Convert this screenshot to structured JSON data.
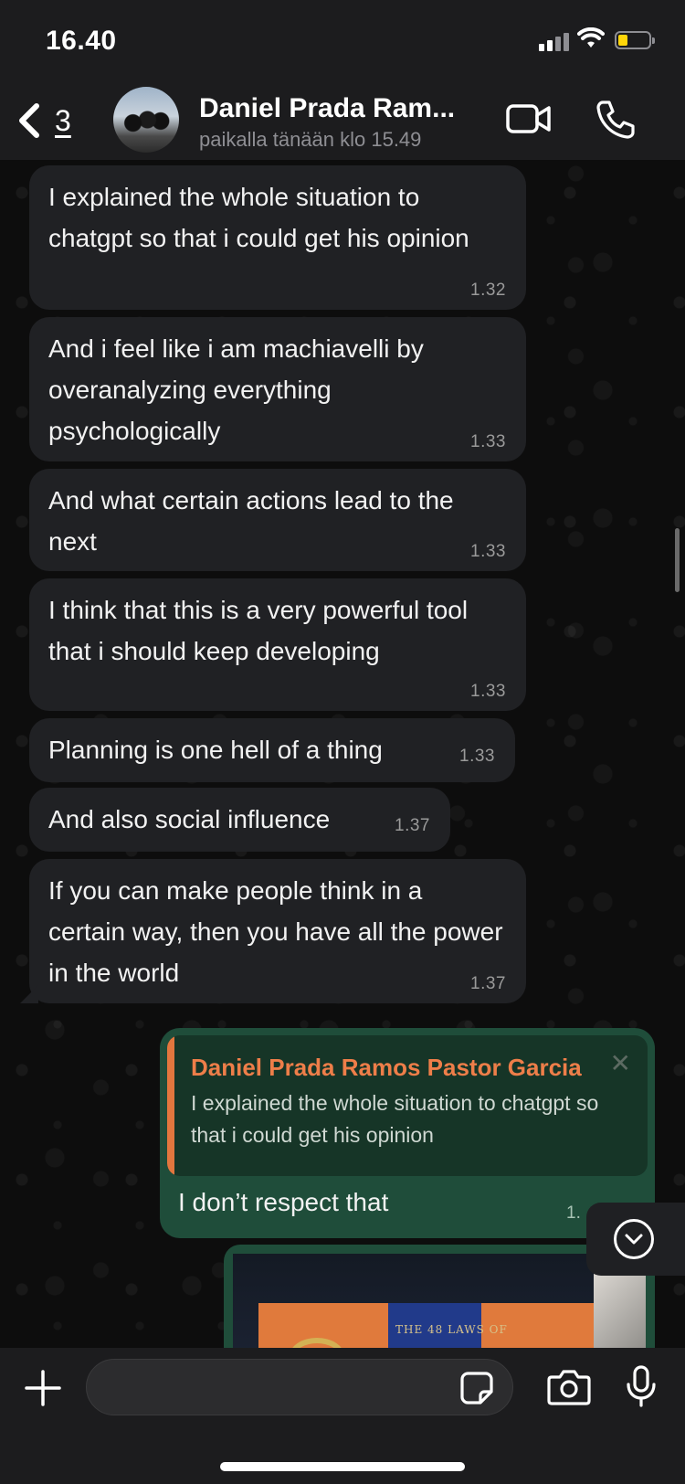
{
  "status_bar": {
    "time": "16.40"
  },
  "header": {
    "back_count": "3",
    "contact_name": "Daniel Prada Ram...",
    "contact_status": "paikalla tänään klo 15.49"
  },
  "messages": [
    {
      "text": "I explained the whole situation to chatgpt so that i could get his opinion",
      "time": "1.32"
    },
    {
      "text": "And i feel like i am machiavelli by overanalyzing everything psychologically",
      "time": "1.33"
    },
    {
      "text": "And what certain actions lead to the next",
      "time": "1.33"
    },
    {
      "text": "I think that this is a very powerful tool that i should keep developing",
      "time": "1.33"
    },
    {
      "text": "Planning is one hell of a thing",
      "time": "1.33"
    },
    {
      "text": "And also social influence",
      "time": "1.37"
    },
    {
      "text": "If you can make people think in a certain way, then you have all the power in the world",
      "time": "1.37"
    }
  ],
  "reply": {
    "quoted_name": "Daniel Prada Ramos Pastor Garcia",
    "quoted_text": "I explained the whole situation to chatgpt so that i could get his opinion",
    "text": "I don’t respect that",
    "time": "1."
  },
  "image_message": {
    "book_title": "THE 48 LAWS OF"
  },
  "composer": {
    "input_value": "",
    "input_placeholder": ""
  },
  "colors": {
    "incoming_bubble": "#202124",
    "outgoing_bubble": "#1f4d3a",
    "quote_accent": "#ee7e49",
    "battery_fill": "#ffd60a"
  }
}
